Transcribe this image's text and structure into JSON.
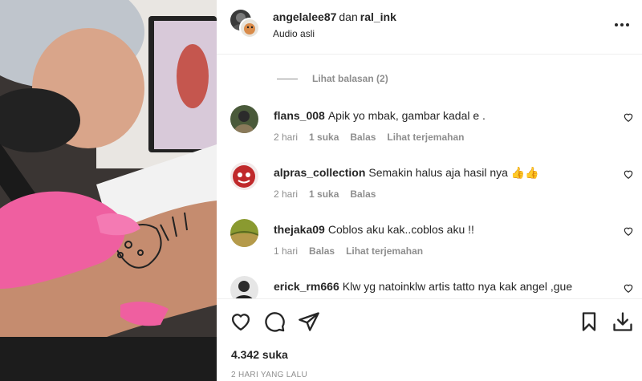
{
  "header": {
    "user1": "angelalee87",
    "joiner": "dan",
    "user2": "ral_ink",
    "audio": "Audio asli"
  },
  "thread": {
    "view_replies": "Lihat balasan (2)"
  },
  "comments": [
    {
      "user": "flans_008",
      "text": "Apik yo mbak, gambar kadal e .",
      "time": "2 hari",
      "likes": "1 suka",
      "reply": "Balas",
      "translate": "Lihat terjemahan"
    },
    {
      "user": "alpras_collection",
      "text": "Semakin halus aja hasil nya 👍👍",
      "time": "2 hari",
      "likes": "1 suka",
      "reply": "Balas"
    },
    {
      "user": "thejaka09",
      "text": "Coblos aku kak..coblos aku !!",
      "time": "1 hari",
      "reply": "Balas",
      "translate": "Lihat terjemahan"
    },
    {
      "user": "erick_rm666",
      "text": "Klw yg natoinklw artis tatto nya kak angel ,gue"
    }
  ],
  "post": {
    "likes": "4.342 suka",
    "date": "2 HARI YANG LALU"
  },
  "icons": [
    "heart-icon",
    "comment-icon",
    "share-icon",
    "bookmark-icon",
    "download-icon",
    "more-icon"
  ]
}
